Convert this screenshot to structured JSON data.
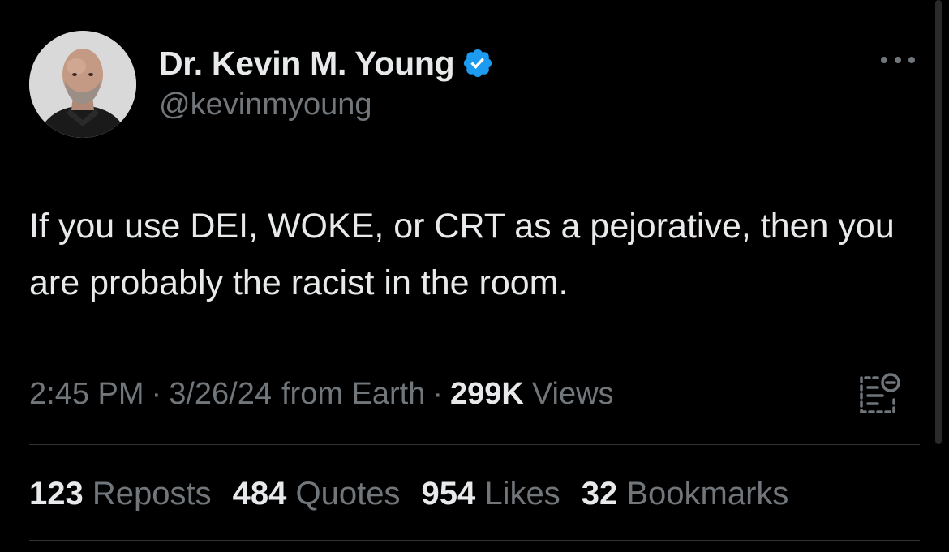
{
  "author": {
    "display_name": "Dr. Kevin M. Young",
    "handle": "@kevinmyoung",
    "verified": true
  },
  "tweet": {
    "text": "If you use DEI, WOKE, or CRT as a pejorative, then you are probably the racist in the room."
  },
  "meta": {
    "time": "2:45 PM",
    "separator": "·",
    "date": "3/26/24",
    "source": "from Earth",
    "views_count": "299K",
    "views_label": "Views"
  },
  "stats": [
    {
      "count": "123",
      "label": "Reposts"
    },
    {
      "count": "484",
      "label": "Quotes"
    },
    {
      "count": "954",
      "label": "Likes"
    },
    {
      "count": "32",
      "label": "Bookmarks"
    }
  ],
  "icons": {
    "verified": "verified-badge-icon",
    "more": "more-options-icon",
    "analytics": "post-analytics-icon"
  },
  "colors": {
    "background": "#000000",
    "primary_text": "#e7e9ea",
    "secondary_text": "#71767b",
    "verified_blue": "#1d9bf0",
    "divider": "#2f3336"
  }
}
